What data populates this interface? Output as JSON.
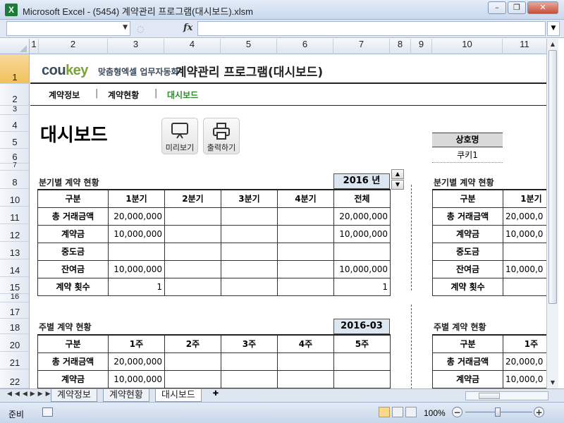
{
  "window": {
    "title": "Microsoft Excel - (5454) 계약관리 프로그램(대시보드).xlsm",
    "app_icon": "X"
  },
  "formula_bar": {
    "name_box": "",
    "formula": "",
    "fx": "fx"
  },
  "columns": [
    "1",
    "2",
    "3",
    "4",
    "5",
    "6",
    "7",
    "8",
    "9",
    "10",
    "11"
  ],
  "rows": [
    "1",
    "2",
    "3",
    "4",
    "5",
    "6",
    "7",
    "8",
    "10",
    "11",
    "12",
    "13",
    "14",
    "15",
    "16",
    "17",
    "18",
    "20",
    "21",
    "22"
  ],
  "header": {
    "logo_main": "cou",
    "logo_key": "key",
    "logo_tag": "맞춤형엑셀 업무자동화",
    "app_title": "계약관리 프로그램(대시보드)"
  },
  "nav": {
    "tab1": "계약정보",
    "tab2": "계약현황",
    "tab3": "대시보드",
    "sep": "|"
  },
  "dashboard": {
    "title": "대시보드",
    "preview_label": "미리보기",
    "print_label": "출력하기",
    "company_header": "상호명",
    "company_value": "쿠키1"
  },
  "quarterly": {
    "title": "분기별 계약 현황",
    "year": "2016 년",
    "headers": [
      "구분",
      "1분기",
      "2분기",
      "3분기",
      "4분기",
      "전체"
    ],
    "rows": [
      [
        "총 거래금액",
        "20,000,000",
        "",
        "",
        "",
        "20,000,000"
      ],
      [
        "계약금",
        "10,000,000",
        "",
        "",
        "",
        "10,000,000"
      ],
      [
        "중도금",
        "",
        "",
        "",
        "",
        ""
      ],
      [
        "잔여금",
        "10,000,000",
        "",
        "",
        "",
        "10,000,000"
      ],
      [
        "계약 횟수",
        "1",
        "",
        "",
        "",
        "1"
      ]
    ]
  },
  "quarterly_right": {
    "title": "분기별 계약 현황",
    "headers": [
      "구분",
      "1분기"
    ],
    "rows": [
      [
        "총 거래금액",
        "20,000,0"
      ],
      [
        "계약금",
        "10,000,0"
      ],
      [
        "중도금",
        ""
      ],
      [
        "잔여금",
        "10,000,0"
      ],
      [
        "계약 횟수",
        ""
      ]
    ]
  },
  "weekly": {
    "title": "주별 계약 현황",
    "month": "2016-03",
    "headers": [
      "구분",
      "1주",
      "2주",
      "3주",
      "4주",
      "5주"
    ],
    "rows": [
      [
        "총 거래금액",
        "20,000,000",
        "",
        "",
        "",
        ""
      ],
      [
        "계약금",
        "10,000,000",
        "",
        "",
        "",
        ""
      ]
    ]
  },
  "weekly_right": {
    "title": "주별 계약 현황",
    "headers": [
      "구분",
      "1주"
    ],
    "rows": [
      [
        "총 거래금액",
        "20,000,0"
      ],
      [
        "계약금",
        "10,000,0"
      ]
    ]
  },
  "sheet_tabs": [
    "계약정보",
    "계약현황",
    "대시보드"
  ],
  "status": {
    "ready": "준비",
    "zoom": "100%"
  },
  "icons": {
    "preview": "monitor-icon",
    "print": "printer-icon",
    "spin_up": "▲",
    "spin_down": "▼"
  }
}
